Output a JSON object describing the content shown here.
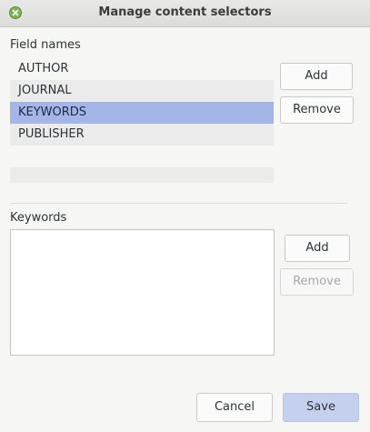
{
  "window": {
    "title": "Manage content selectors"
  },
  "field_names": {
    "label": "Field names",
    "items": [
      "AUTHOR",
      "JOURNAL",
      "KEYWORDS",
      "PUBLISHER"
    ],
    "selected": "KEYWORDS",
    "add_label": "Add",
    "remove_label": "Remove"
  },
  "keywords": {
    "label": "Keywords",
    "value": "",
    "add_label": "Add",
    "remove_label": "Remove"
  },
  "footer": {
    "cancel_label": "Cancel",
    "save_label": "Save"
  },
  "colors": {
    "selection": "#a4b6e7",
    "primary_button": "#c4d0ee",
    "close_button": "#7fb255"
  }
}
